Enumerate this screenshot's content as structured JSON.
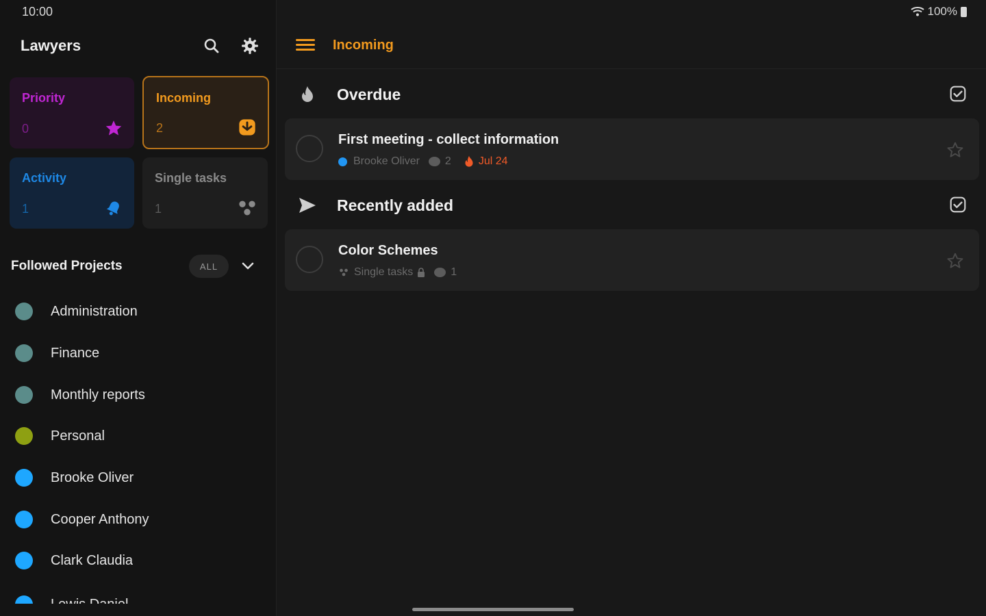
{
  "status_bar": {
    "time": "10:00",
    "battery": "100%"
  },
  "sidebar": {
    "title": "Lawyers",
    "tiles": [
      {
        "label": "Priority",
        "count": "0",
        "icon": "star-icon",
        "color": "#c026d3"
      },
      {
        "label": "Incoming",
        "count": "2",
        "icon": "inbox-icon",
        "color": "#f29a1e"
      },
      {
        "label": "Activity",
        "count": "1",
        "icon": "bell-icon",
        "color": "#1e88e5"
      },
      {
        "label": "Single tasks",
        "count": "1",
        "icon": "nodes-icon",
        "color": "#9e9e9e"
      }
    ],
    "followed_projects": {
      "title": "Followed Projects",
      "filter": "ALL",
      "items": [
        {
          "name": "Administration",
          "color": "#5b8c8a"
        },
        {
          "name": "Finance",
          "color": "#5b8c8a"
        },
        {
          "name": "Monthly reports",
          "color": "#5b8c8a"
        },
        {
          "name": "Personal",
          "color": "#8ea012"
        },
        {
          "name": "Brooke Oliver",
          "color": "#1ea7ff"
        },
        {
          "name": "Cooper Anthony",
          "color": "#1ea7ff"
        },
        {
          "name": "Clark Claudia",
          "color": "#1ea7ff"
        },
        {
          "name": "Lewis Daniel",
          "color": "#1ea7ff"
        }
      ]
    }
  },
  "main": {
    "title": "Incoming",
    "sections": [
      {
        "title": "Overdue",
        "icon": "fire-icon",
        "task": {
          "title": "First meeting - collect information",
          "assignee": "Brooke Oliver",
          "comments": "2",
          "due": "Jul 24"
        }
      },
      {
        "title": "Recently added",
        "icon": "send-icon",
        "task": {
          "title": "Color Schemes",
          "project": "Single tasks",
          "comments": "1"
        }
      }
    ]
  },
  "colors": {
    "accent": "#f29a1e",
    "background": "#161616",
    "card": "#222222",
    "overdue": "#f05a28"
  }
}
